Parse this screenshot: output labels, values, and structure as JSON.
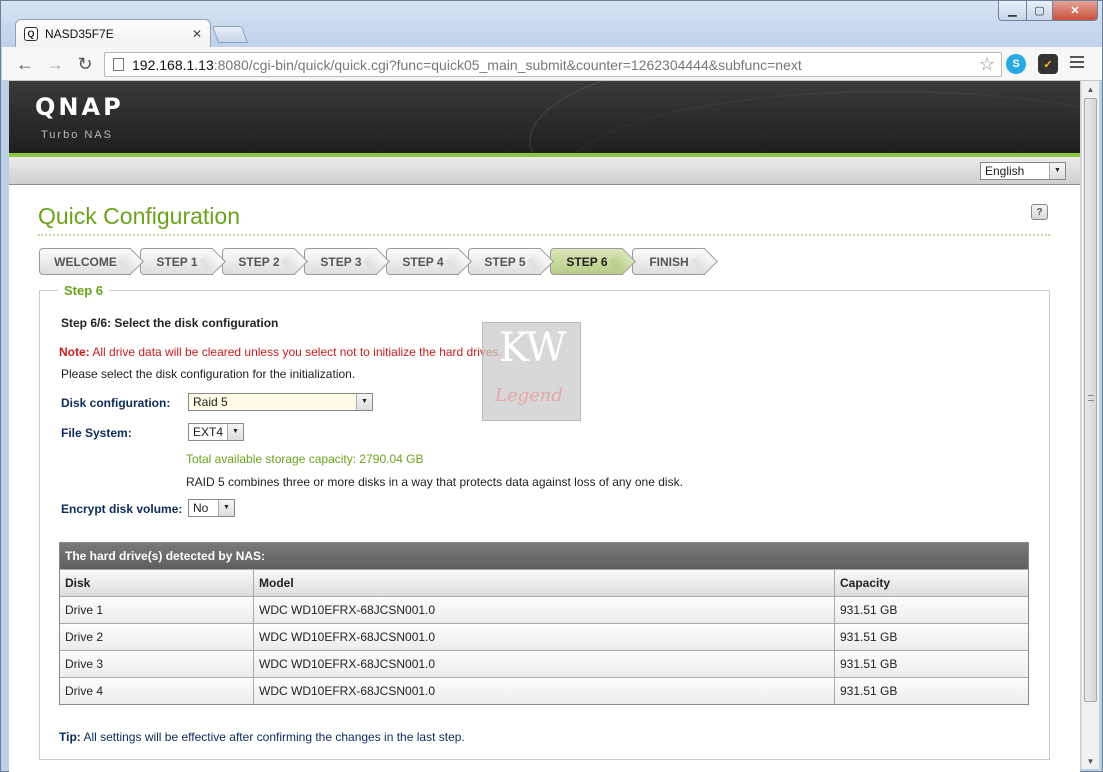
{
  "browser": {
    "tab_title": "NASD35F7E",
    "tab_favicon": "Q",
    "url_host": "192.168.1.13",
    "url_rest": ":8080/cgi-bin/quick/quick.cgi?func=quick05_main_submit&counter=1262304444&subfunc=next"
  },
  "header": {
    "logo": "QNAP",
    "logo_sub": "Turbo NAS",
    "language": "English"
  },
  "page": {
    "title": "Quick Configuration",
    "help": "?"
  },
  "steps": [
    "WELCOME",
    "STEP 1",
    "STEP 2",
    "STEP 3",
    "STEP 4",
    "STEP 5",
    "STEP 6",
    "FINISH"
  ],
  "active_step": "STEP 6",
  "step6": {
    "legend": "Step 6",
    "heading": "Step 6/6: Select the disk configuration",
    "note_label": "Note:",
    "note_text": " All drive data will be cleared unless you select not to initialize the hard drives.",
    "instruction": "Please select the disk configuration for the initialization.",
    "disk_config_label": "Disk configuration:",
    "disk_config_value": "Raid 5",
    "fs_label": "File System:",
    "fs_value": "EXT4",
    "capacity_text": "Total available storage capacity: 2790.04 GB",
    "raid_desc": "RAID 5 combines three or more disks in a way that protects data against loss of any one disk.",
    "encrypt_label": "Encrypt disk volume:",
    "encrypt_value": "No",
    "tip_label": "Tip:",
    "tip_text": " All settings will be effective after confirming the changes in the last step."
  },
  "drives_table": {
    "caption": "The hard drive(s) detected by NAS:",
    "headers": [
      "Disk",
      "Model",
      "Capacity"
    ],
    "rows": [
      [
        "Drive 1",
        "WDC WD10EFRX-68JCSN001.0",
        "931.51 GB"
      ],
      [
        "Drive 2",
        "WDC WD10EFRX-68JCSN001.0",
        "931.51 GB"
      ],
      [
        "Drive 3",
        "WDC WD10EFRX-68JCSN001.0",
        "931.51 GB"
      ],
      [
        "Drive 4",
        "WDC WD10EFRX-68JCSN001.0",
        "931.51 GB"
      ]
    ]
  },
  "watermark": {
    "kw": "KW",
    "legend": "Legend"
  }
}
